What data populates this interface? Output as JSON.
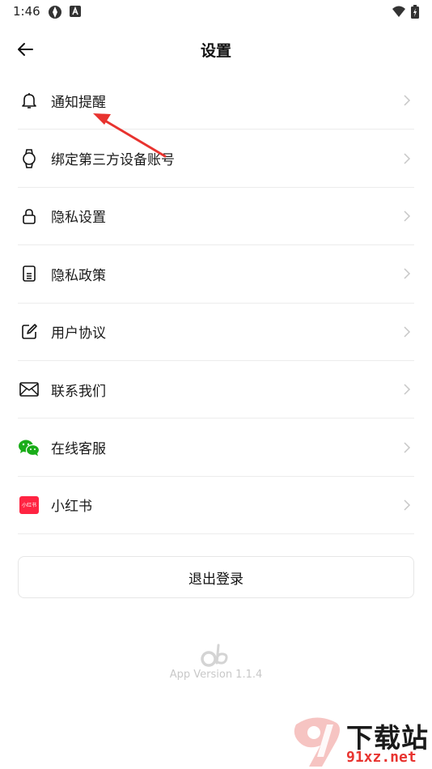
{
  "status_bar": {
    "time": "1:46"
  },
  "header": {
    "title": "设置"
  },
  "menu": {
    "items": [
      {
        "label": "通知提醒",
        "icon": "bell-icon"
      },
      {
        "label": "绑定第三方设备账号",
        "icon": "smartwatch-icon"
      },
      {
        "label": "隐私设置",
        "icon": "lock-icon"
      },
      {
        "label": "隐私政策",
        "icon": "document-icon"
      },
      {
        "label": "用户协议",
        "icon": "edit-icon"
      },
      {
        "label": "联系我们",
        "icon": "mail-icon"
      },
      {
        "label": "在线客服",
        "icon": "wechat-icon"
      },
      {
        "label": "小红书",
        "icon": "xiaohongshu-icon",
        "icon_text": "小红书"
      }
    ]
  },
  "logout_label": "退出登录",
  "footer": {
    "version": "App Version 1.1.4"
  },
  "watermark": {
    "big": "下载站",
    "small": "91xz.net"
  },
  "colors": {
    "accent_red": "#e8332f",
    "xhs_red": "#ff2442",
    "wechat_green": "#1aad19",
    "divider": "#ececec"
  }
}
